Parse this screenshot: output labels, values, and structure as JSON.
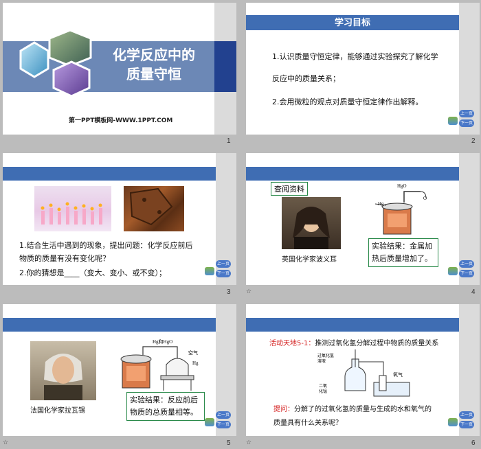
{
  "slides": [
    {
      "number": "1",
      "title_line1": "化学反应中的",
      "title_line2": "质量守恒",
      "footer": "第一PPT模板网-WWW.1PPT.COM"
    },
    {
      "number": "2",
      "header": "学习目标",
      "line1": "1.认识质量守恒定律，能够通过实验探究了解化学",
      "line2": "反应中的质量关系；",
      "line3": "2.会用微粒的观点对质量守恒定律作出解释。"
    },
    {
      "number": "3",
      "line1": "1.结合生活中遇到的现象，提出问题：化学反应前后",
      "line2": "物质的质量有没有变化呢？",
      "line3": "2.你的猜想是____（变大、变小、或不变）；"
    },
    {
      "number": "4",
      "label": "查阅资料",
      "caption": "英国化学家波义耳",
      "hgo_label": "HgO",
      "hg_label": "Hg",
      "o_label": "O",
      "result": "实验结果：金属加热后质量增加了。"
    },
    {
      "number": "5",
      "caption": "法国化学家拉瓦锡",
      "hg_hgo_label": "Hg和HgO",
      "air_label": "空气",
      "hg_label": "Hg",
      "result": "实验结果：反应前后物质的总质量相等。"
    },
    {
      "number": "6",
      "activity_label": "活动天地5-1：",
      "activity_text": "推测过氧化氢分解过程中物质的质量关系",
      "h2o2_label": "过氧化氢溶液",
      "mno2_label": "二氧化锰",
      "o2_label": "氧气",
      "question_label": "提问：",
      "question_text1": "分解了的过氧化氢的质量与生成的水和氧气的",
      "question_text2": "质量具有什么关系呢？"
    }
  ],
  "nav": {
    "prev": "上一页",
    "next": "下一页"
  },
  "star_glyph": "☆"
}
